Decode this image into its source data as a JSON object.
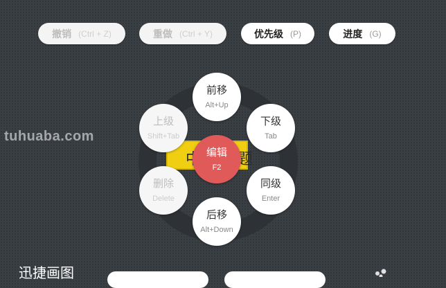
{
  "toolbar": {
    "undo": {
      "label": "撤销",
      "shortcut": "(Ctrl + Z)"
    },
    "redo": {
      "label": "重做",
      "shortcut": "(Ctrl + Y)"
    },
    "priority": {
      "label": "优先级",
      "shortcut": "(P)"
    },
    "progress": {
      "label": "进度",
      "shortcut": "(G)"
    }
  },
  "topic": {
    "left_text": "中",
    "right_text": "题"
  },
  "radial_menu": {
    "center": {
      "label": "编辑",
      "shortcut": "F2"
    },
    "up": {
      "label": "前移",
      "shortcut": "Alt+Up"
    },
    "down_level": {
      "label": "下级",
      "shortcut": "Tab"
    },
    "sibling": {
      "label": "同级",
      "shortcut": "Enter"
    },
    "down": {
      "label": "后移",
      "shortcut": "Alt+Down"
    },
    "delete": {
      "label": "删除",
      "shortcut": "Delete"
    },
    "up_level": {
      "label": "上级",
      "shortcut": "Shift+Tab"
    }
  },
  "watermark": "tuhuaba.com",
  "brand": "迅捷画图"
}
